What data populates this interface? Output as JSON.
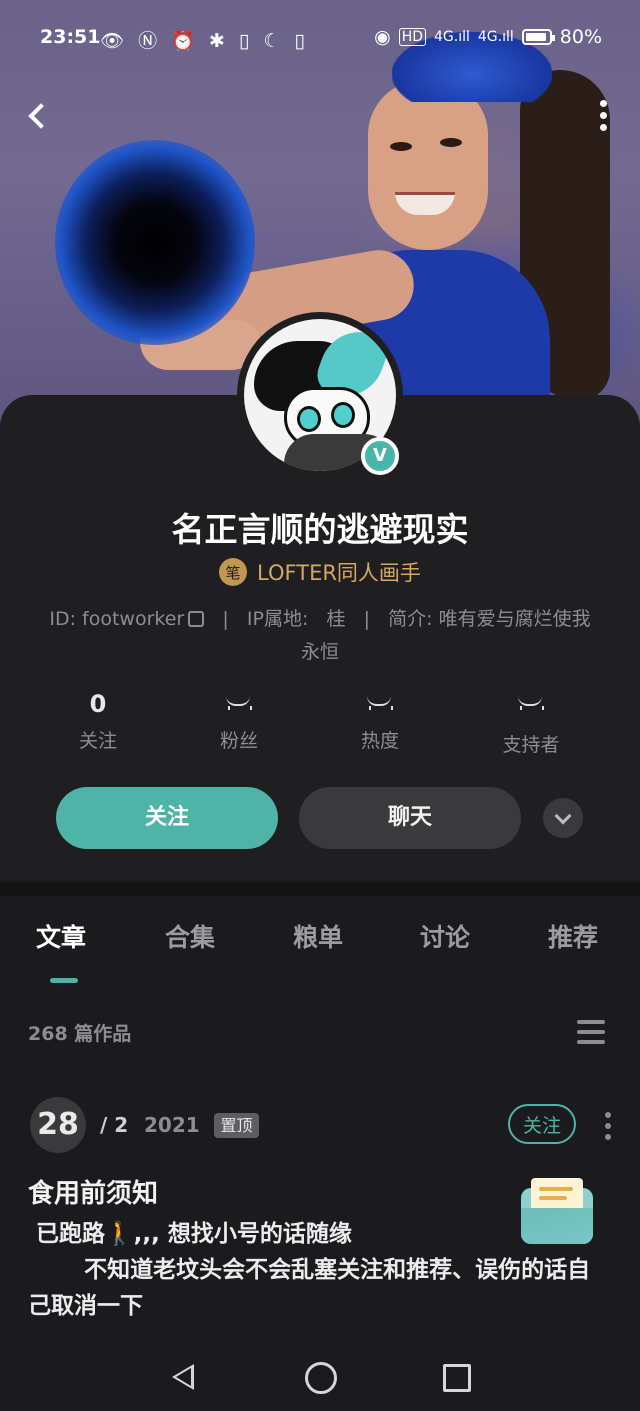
{
  "status_bar": {
    "time": "23:51",
    "left_icons": "👁 Ⓝ ⏰ ✱ ▯ ☾ ▯",
    "network": "HD",
    "signal_1": "4G.ıll",
    "signal_2": "4G.ıll",
    "battery": "80%"
  },
  "profile": {
    "name": "名正言顺的逃避现实",
    "verified_mark": "V",
    "role_icon": "笔",
    "role": "LOFTER同人画手",
    "id_text": "ID: footworker",
    "sep1": "|",
    "ip_label": "IP属地:",
    "ip_value": "桂",
    "sep2": "|",
    "bio_label": "简介:",
    "bio": "唯有爱与腐烂使我永恒"
  },
  "stats": [
    {
      "value": "0",
      "label": "关注"
    },
    {
      "value": "",
      "label": "粉丝"
    },
    {
      "value": "",
      "label": "热度"
    },
    {
      "value": "",
      "label": "支持者"
    }
  ],
  "actions": {
    "follow": "关注",
    "chat": "聊天"
  },
  "tabs": [
    "文章",
    "合集",
    "粮单",
    "讨论",
    "推荐"
  ],
  "works_count": "268 篇作品",
  "post": {
    "day": "28",
    "month": "/ 2",
    "year": "2021",
    "pinned": "置顶",
    "follow": "关注",
    "title": "食用前须知",
    "line1": " 已跑路🚶,,, 想找小号的话随缘",
    "line2": "       不知道老坟头会不会乱塞关注和推荐、误伤的话自己取消一下"
  },
  "colors": {
    "accent": "#4fb4a8",
    "role_gold": "#d4a860",
    "card_bg": "#1f1f21"
  }
}
